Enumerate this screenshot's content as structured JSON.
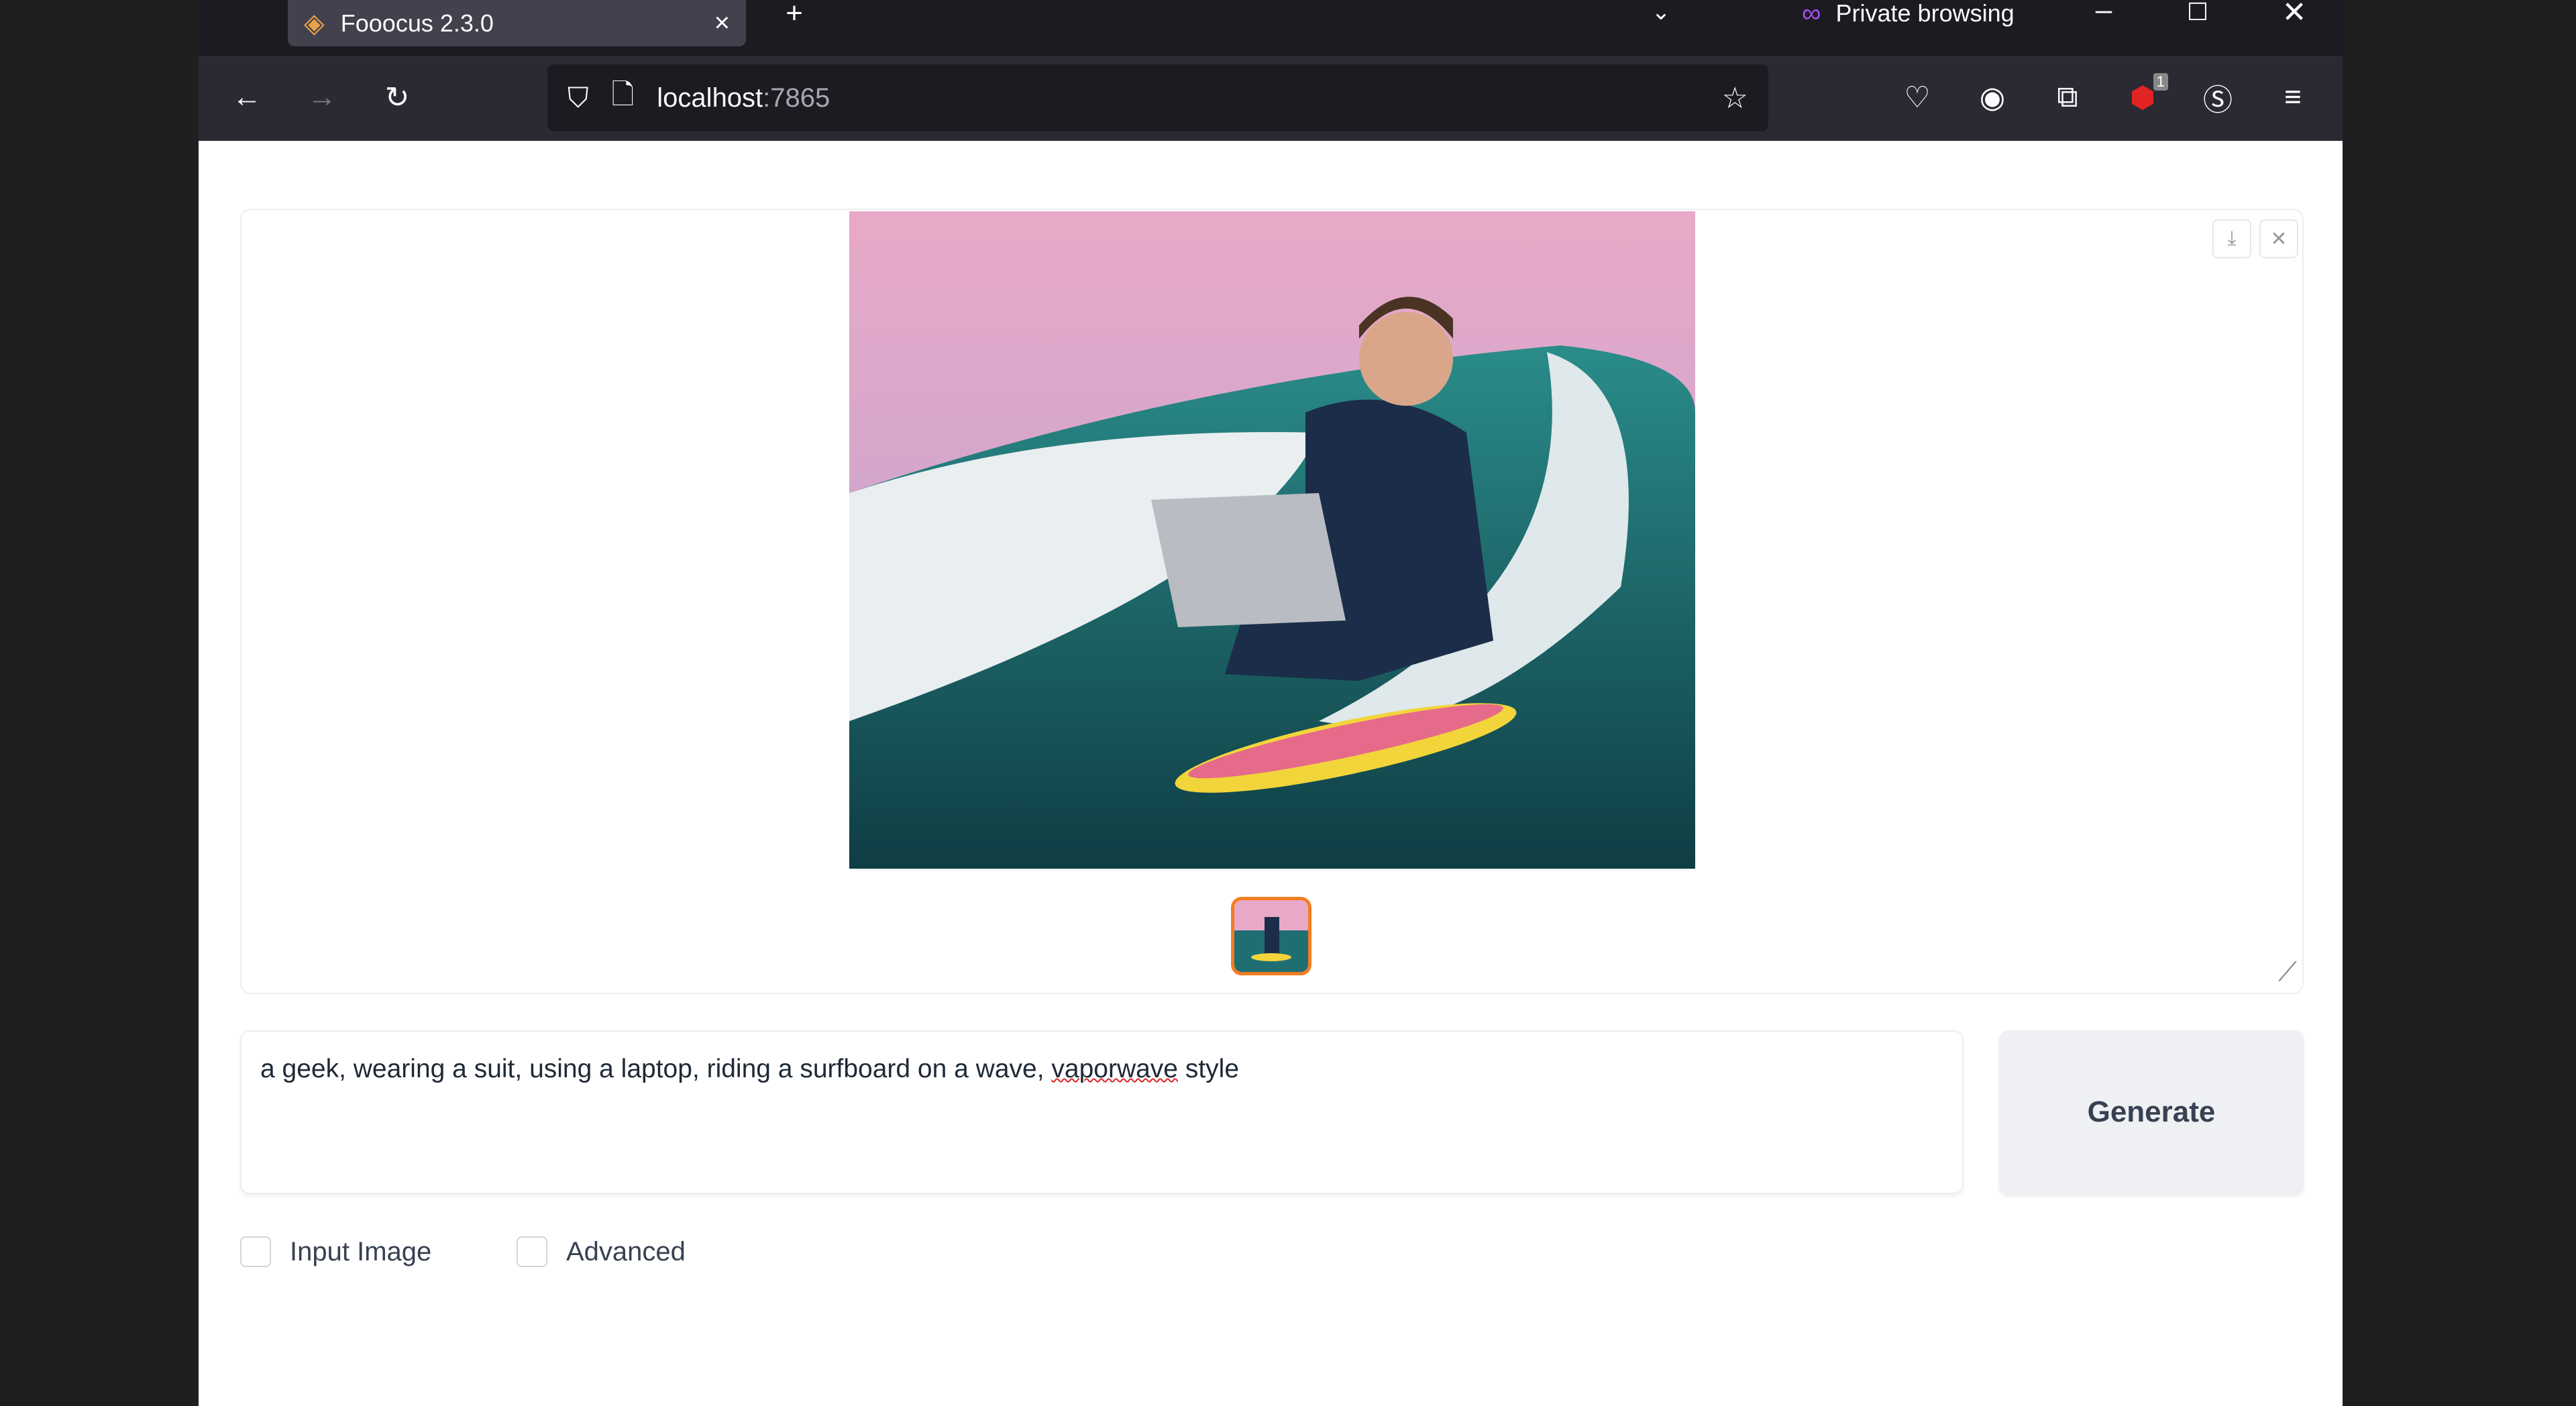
{
  "browser": {
    "tab_title": "Fooocus 2.3.0",
    "private_label": "Private browsing",
    "url_host": "localhost",
    "url_port": ":7865",
    "extension_badge": "1"
  },
  "gallery": {
    "image_alt": "geek in suit with laptop riding a surfboard on a wave"
  },
  "prompt": {
    "text_before": "a geek, wearing a suit, using a laptop, riding a surfboard on a wave, ",
    "misspelled": "vaporwave",
    "text_after": " style"
  },
  "generate_label": "Generate",
  "options": {
    "input_image": "Input Image",
    "advanced": "Advanced"
  },
  "colors": {
    "accent": "#f47c20",
    "browser_chrome": "#1c1b22",
    "toolbar": "#2b2a33"
  }
}
